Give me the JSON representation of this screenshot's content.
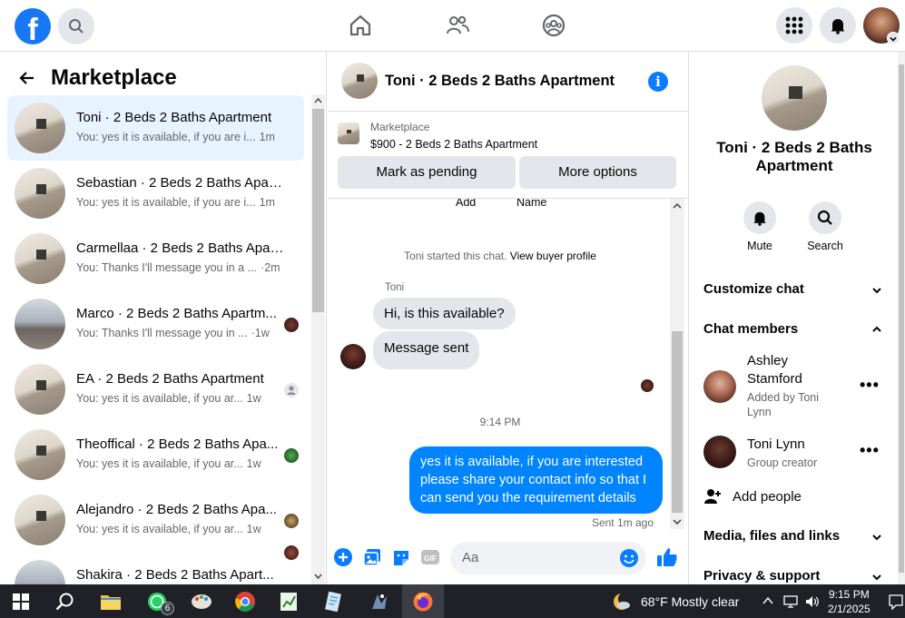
{
  "topbar": {
    "logo": "f",
    "icons": [
      "search-icon",
      "home-icon",
      "friends-icon",
      "groups-icon",
      "menu-grid-icon",
      "notifications-icon",
      "profile-avatar"
    ]
  },
  "left": {
    "title": "Marketplace",
    "conversations": [
      {
        "name": "Toni · 2 Beds 2 Baths Apartment",
        "snippet": "You: yes it is available, if you are i...",
        "time": "1m",
        "active": true,
        "seen": "none"
      },
      {
        "name": "Sebastian · 2 Beds 2 Baths Apart...",
        "snippet": "You: yes it is available, if you are i...",
        "time": "1m",
        "active": false,
        "seen": "none"
      },
      {
        "name": "Carmellaa · 2 Beds 2 Baths Apart...",
        "snippet": "You: Thanks I'll message you in a ...",
        "time": "·2m",
        "active": false,
        "seen": "none"
      },
      {
        "name": "Marco · 2 Beds 2 Baths Apartm...",
        "snippet": "You: Thanks I'll message you in ...",
        "time": "·1w",
        "active": false,
        "seen": "avatar"
      },
      {
        "name": "EA · 2 Beds 2 Baths Apartment",
        "snippet": "You: yes it is available, if you ar...",
        "time": "1w",
        "active": false,
        "seen": "grey"
      },
      {
        "name": "Theoffical · 2 Beds 2 Baths Apa...",
        "snippet": "You: yes it is available, if you ar...",
        "time": "1w",
        "active": false,
        "seen": "avatar"
      },
      {
        "name": "Alejandro · 2 Beds 2 Baths Apa...",
        "snippet": "You: yes it is available, if you ar...",
        "time": "1w",
        "active": false,
        "seen": "avatar"
      },
      {
        "name": "Shakira · 2 Beds 2 Baths Apart...",
        "snippet": "",
        "time": "",
        "active": false,
        "seen": "avatar"
      }
    ]
  },
  "chat": {
    "header_name": "Toni · 2 Beds 2 Baths Apartment",
    "marketplace_label": "Marketplace",
    "listing": "$900 - 2 Beds 2 Baths Apartment",
    "mark_pending": "Mark as pending",
    "more_options": "More options",
    "fragment_add": "Add",
    "fragment_name": "Name",
    "system_text": "Toni started this chat.",
    "view_profile": "View buyer profile",
    "sender": "Toni",
    "msg1": "Hi, is this available?",
    "msg2": "Message sent",
    "timestamp": "9:14 PM",
    "outgoing": "yes it is available, if you are interested please share your contact info so that I can send you the requirement details",
    "sent_status": "Sent 1m ago",
    "input_placeholder": "Aa"
  },
  "details": {
    "title": "Toni · 2 Beds 2 Baths Apartment",
    "mute": "Mute",
    "search": "Search",
    "customize": "Customize chat",
    "members_heading": "Chat members",
    "members": [
      {
        "name": "Ashley Stamford",
        "sub": "Added by Toni Lynn"
      },
      {
        "name": "Toni Lynn",
        "sub": "Group creator"
      }
    ],
    "add_people": "Add people",
    "media": "Media, files and links",
    "privacy": "Privacy & support"
  },
  "taskbar": {
    "whatsapp_badge": "6",
    "weather": "68°F  Mostly clear",
    "time": "9:15 PM",
    "date": "2/1/2025"
  },
  "colors": {
    "brand": "#1877f2",
    "messenger_blue": "#0084ff",
    "taskbar": "#1f2126"
  }
}
